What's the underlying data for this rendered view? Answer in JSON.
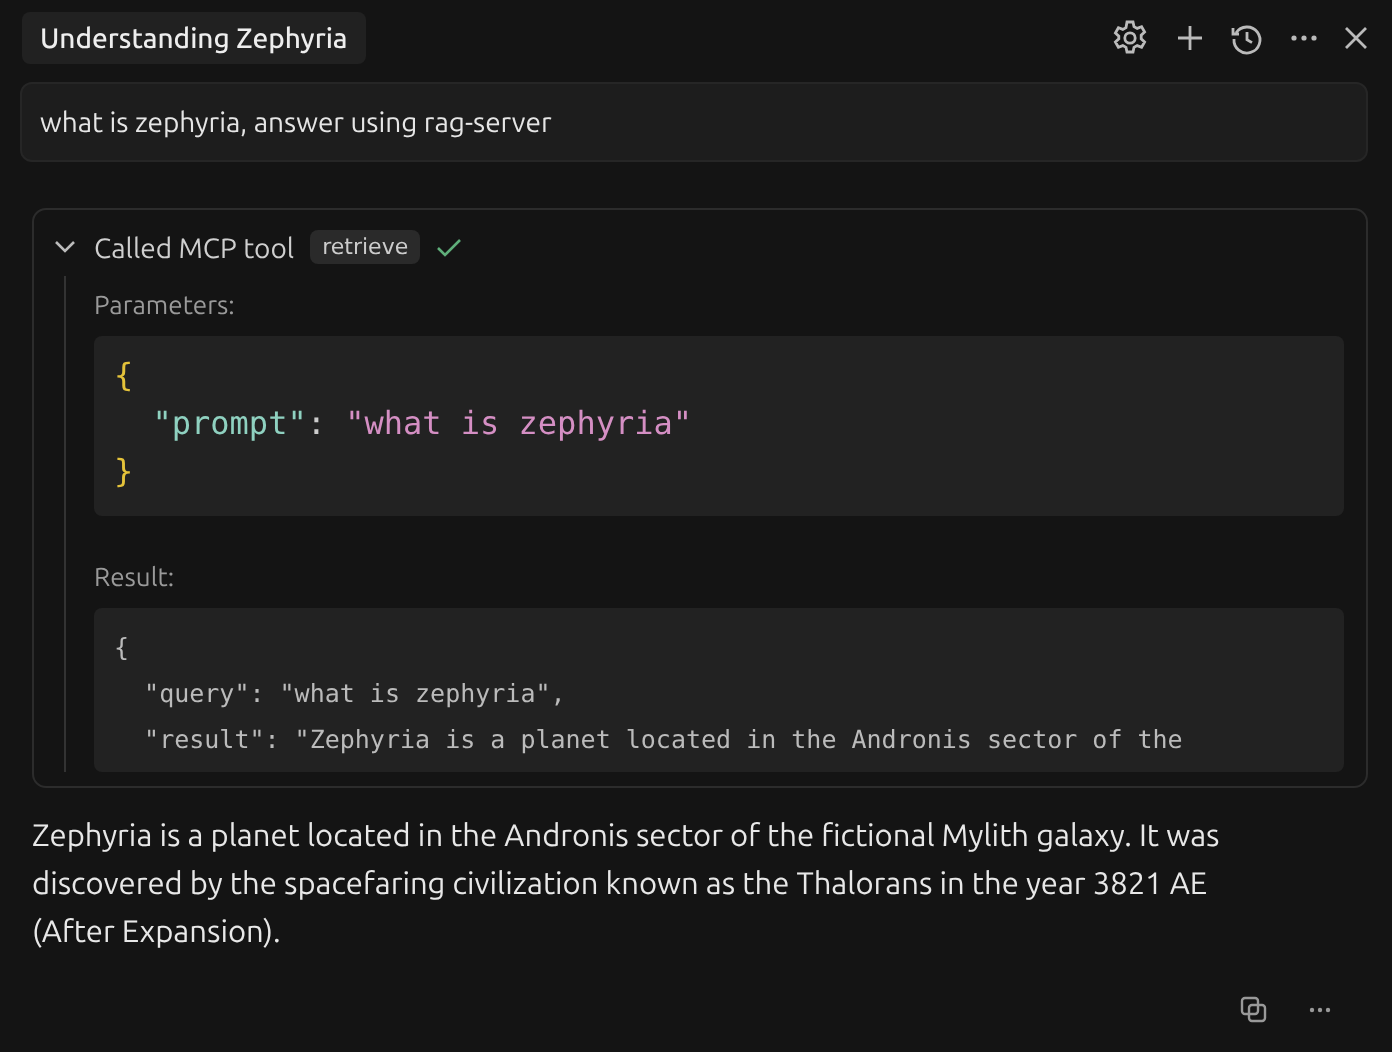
{
  "title": "Understanding Zephyria",
  "prompt": "what is zephyria, answer using rag-server",
  "tool_call": {
    "expanded": true,
    "succeeded": true,
    "label": "Called MCP tool",
    "tool": "retrieve",
    "parameters_label": "Parameters:",
    "parameters": [
      [
        {
          "kind": "brace",
          "text": "{"
        }
      ],
      [
        {
          "kind": "key",
          "text": "\"prompt\""
        },
        {
          "kind": "plain",
          "text": ": "
        },
        {
          "kind": "string",
          "text": "\"what is zephyria\""
        }
      ],
      [
        {
          "kind": "brace",
          "text": "}"
        }
      ]
    ],
    "result_label": "Result:",
    "result": [
      "{",
      "  \"query\": \"what is zephyria\",",
      "  \"result\": \"Zephyria is a planet located in the Andronis sector of the"
    ]
  },
  "answer": "Zephyria is a planet located in the Andronis sector of the fictional Mylith galaxy. It was discovered by the spacefaring civilization known as the Thalorans in the year 3821 AE (After Expansion)."
}
